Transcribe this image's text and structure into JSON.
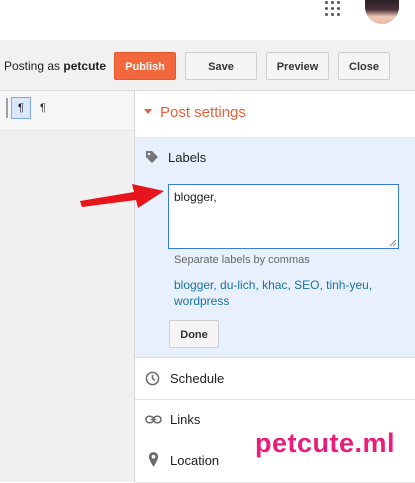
{
  "toolbar": {
    "posting_as_prefix": "Posting as",
    "username": "petcute",
    "publish_label": "Publish",
    "save_label": "Save",
    "preview_label": "Preview",
    "close_label": "Close"
  },
  "editor": {
    "ltr_symbol": "¶",
    "rtl_symbol": "¶"
  },
  "post_settings": {
    "title": "Post settings",
    "labels": {
      "title": "Labels",
      "input_value": "blogger, ",
      "hint": "Separate labels by commas",
      "suggestions": [
        "blogger",
        "du-lich",
        "khac",
        "SEO",
        "tinh-yeu",
        "wordpress"
      ],
      "done_label": "Done"
    },
    "schedule_label": "Schedule",
    "links_label": "Links",
    "location_label": "Location"
  },
  "watermark": "petcute.ml",
  "colors": {
    "publish": "#f2683c",
    "accent": "#e8603a",
    "link": "#1a73a8",
    "labels_panel_bg": "#e8f0fd",
    "arrow": "#e8141c",
    "watermark": "#ec1c7a"
  },
  "icons": [
    "apps-grid-icon",
    "avatar",
    "caret-down-icon",
    "tag-icon",
    "clock-icon",
    "link-icon",
    "location-pin-icon",
    "red-arrow"
  ]
}
